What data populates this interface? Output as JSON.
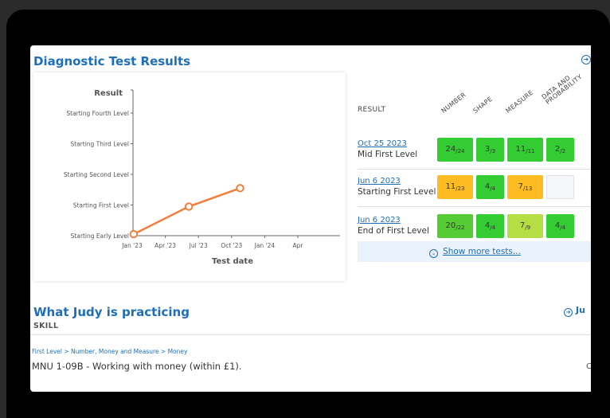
{
  "diagnostic": {
    "title": "Diagnostic Test Results"
  },
  "chart_data": {
    "type": "line",
    "ylabel": "Result",
    "xlabel": "Test date",
    "y_categories": [
      "Starting Early Level",
      "Starting First Level",
      "Starting Second Level",
      "Starting Third Level",
      "Starting Fourth Level"
    ],
    "x_ticks": [
      "Jan '23",
      "Apr '23",
      "Jul '23",
      "Oct '23",
      "Jan '24",
      "Apr"
    ],
    "series": [
      {
        "points": [
          {
            "x": "2023-01-05",
            "y": 0.05
          },
          {
            "x": "2023-06-06",
            "y": 0.95
          },
          {
            "x": "2023-10-25",
            "y": 1.55
          }
        ]
      }
    ],
    "line_color": "#f07f3c",
    "grid": false
  },
  "results": {
    "header": "RESULT",
    "columns": [
      "NUMBER",
      "SHAPE",
      "MEASURE",
      "DATA AND PROBABILITY"
    ],
    "rows": [
      {
        "date": "Oct 25 2023",
        "level": "Mid First Level",
        "cells": [
          {
            "score": "24",
            "total": "24",
            "color": "#33cc33"
          },
          {
            "score": "3",
            "total": "3",
            "color": "#33cc33"
          },
          {
            "score": "11",
            "total": "11",
            "color": "#33cc33"
          },
          {
            "score": "2",
            "total": "2",
            "color": "#33cc33"
          }
        ]
      },
      {
        "date": "Jun 6 2023",
        "level": "Starting First Level",
        "cells": [
          {
            "score": "11",
            "total": "23",
            "color": "#ffbb22"
          },
          {
            "score": "4",
            "total": "4",
            "color": "#33cc33"
          },
          {
            "score": "7",
            "total": "13",
            "color": "#ffbb22"
          },
          {
            "score": "",
            "total": "",
            "color": "#f4f6f8"
          }
        ]
      },
      {
        "date": "Jun 6 2023",
        "level": "End of First Level",
        "cells": [
          {
            "score": "20",
            "total": "22",
            "color": "#55cc33"
          },
          {
            "score": "4",
            "total": "4",
            "color": "#33cc33"
          },
          {
            "score": "7",
            "total": "9",
            "color": "#b5dd44"
          },
          {
            "score": "4",
            "total": "4",
            "color": "#33cc33"
          }
        ]
      }
    ],
    "show_more": "Show more tests..."
  },
  "practicing": {
    "title": "What Judy is practicing",
    "right_link": "Ju",
    "skill_header": "SKILL",
    "breadcrumb": "First Level > Number, Money and Measure > Money",
    "skill_name": "MNU 1-09B - Working with money (within £1).",
    "edge_text": "C"
  }
}
